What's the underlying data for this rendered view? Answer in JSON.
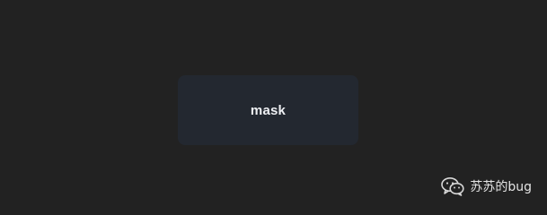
{
  "card": {
    "label": "mask"
  },
  "watermark": {
    "icon": "wechat-icon",
    "text": "苏苏的bug"
  }
}
